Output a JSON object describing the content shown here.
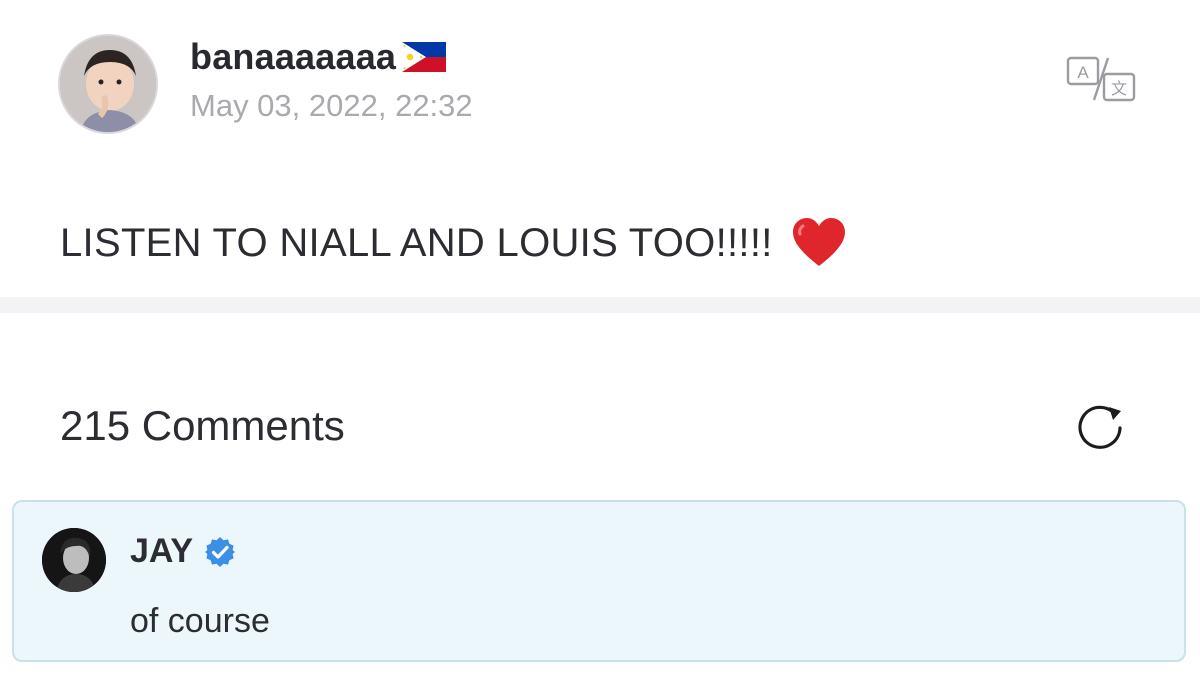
{
  "post": {
    "username": "banaaaaaaa",
    "flag_icon": "philippines-flag-icon",
    "timestamp": "May 03, 2022, 22:32",
    "body": "LISTEN TO NIALL AND LOUIS TOO!!!!!",
    "emoji_icon": "red-heart-icon",
    "translate_icon": "translate-icon"
  },
  "comments": {
    "count_label": "215 Comments",
    "refresh_icon": "refresh-icon",
    "items": [
      {
        "author": "JAY",
        "verified": true,
        "verified_icon": "verified-badge-icon",
        "text": "of course"
      }
    ]
  },
  "colors": {
    "accent_verified": "#3d8fe6",
    "comment_card_bg": "#ecf7fc",
    "comment_card_border": "#c9e2ea",
    "timestamp": "#a8aab0",
    "divider": "#f3f3f6"
  }
}
